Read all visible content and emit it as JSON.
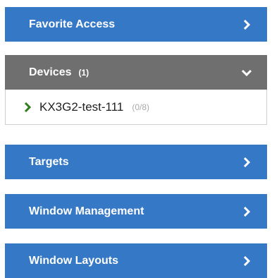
{
  "panels": {
    "favorite_access": {
      "label": "Favorite Access"
    },
    "devices": {
      "label": "Devices",
      "count": "(1)"
    },
    "device_item": {
      "name": "KX3G2-test-111",
      "status": "(0/8)"
    },
    "targets": {
      "label": "Targets"
    },
    "window_management": {
      "label": "Window Management"
    },
    "window_layouts": {
      "label": "Window Layouts"
    }
  },
  "icons": {
    "collapsed": "chevron-right-icon",
    "expanded": "chevron-down-icon",
    "device": "chevron-right-icon"
  },
  "colors": {
    "panel_blue": "#3578c5",
    "panel_grey": "#6f6f6f",
    "device_chevron_green": "#2e7d1e",
    "status_grey": "#a9a9a9"
  }
}
